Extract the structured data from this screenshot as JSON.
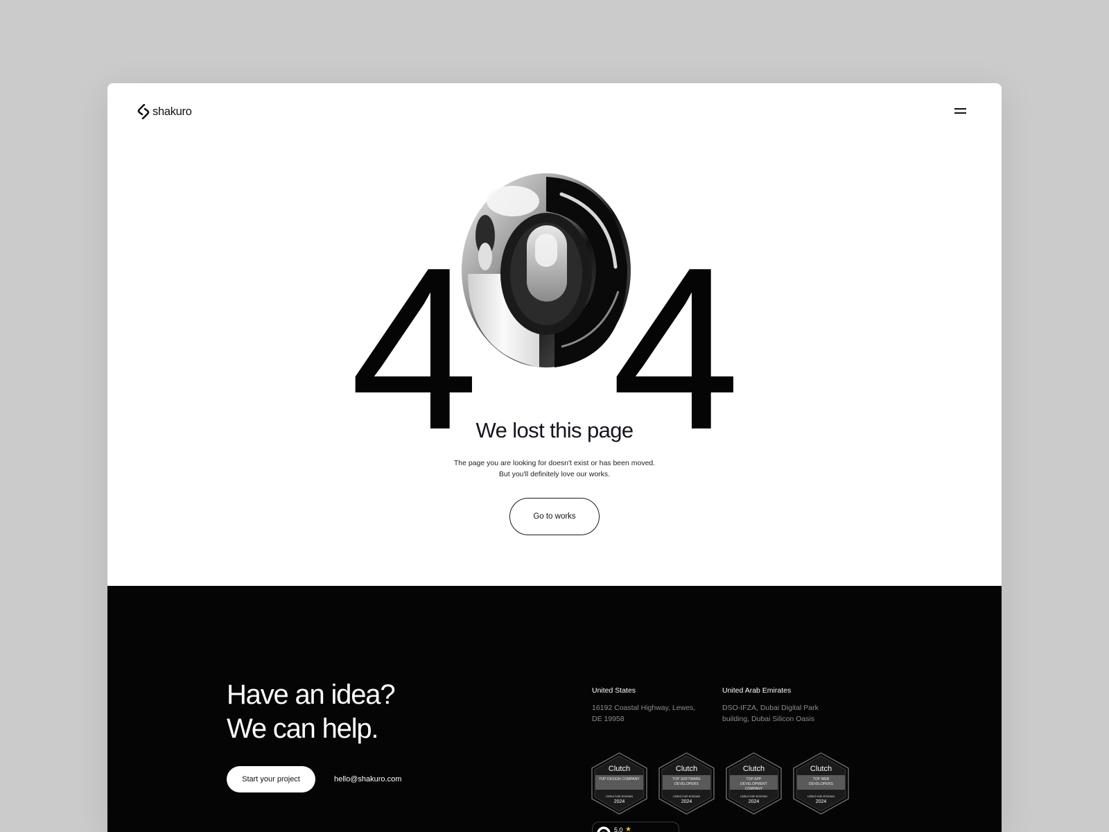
{
  "brand": {
    "name": "shakuro"
  },
  "hero": {
    "digit_left": "4",
    "digit_right": "4",
    "title": "We lost this page",
    "description_line1": "The page you are looking for doesn't exist or has been moved.",
    "description_line2": "But you'll definitely love our works.",
    "button_label": "Go to works"
  },
  "footer": {
    "cta_line1": "Have an idea?",
    "cta_line2": "We can help.",
    "start_button": "Start your project",
    "email": "hello@shakuro.com",
    "offices": [
      {
        "name": "United States",
        "address_line1": "16192 Coastal Highway, Lewes,",
        "address_line2": "DE 19958"
      },
      {
        "name": "United Arab Emirates",
        "address_line1": "DSO-IFZA, Dubai Digital Park",
        "address_line2": "building, Dubai Silicon Oasis"
      }
    ],
    "badges": [
      {
        "brand": "Clutch",
        "category": "Top Design Company",
        "region": "United Arab Emirates",
        "year": "2024"
      },
      {
        "brand": "Clutch",
        "category": "Top Software Developers",
        "region": "United Arab Emirates",
        "year": "2024"
      },
      {
        "brand": "Clutch",
        "category": "Top App Development Company",
        "region": "United Arab Emirates",
        "year": "2024"
      },
      {
        "brand": "Clutch",
        "category": "Top Web Developers",
        "region": "United Arab Emirates",
        "year": "2024"
      }
    ],
    "rating": {
      "value": "5,0",
      "icon": "star-icon"
    }
  },
  "colors": {
    "page_bg": "#cbcbcb",
    "frame_bg": "#ffffff",
    "footer_bg": "#050505",
    "text_dark": "#15151f",
    "star": "#f5c518"
  }
}
